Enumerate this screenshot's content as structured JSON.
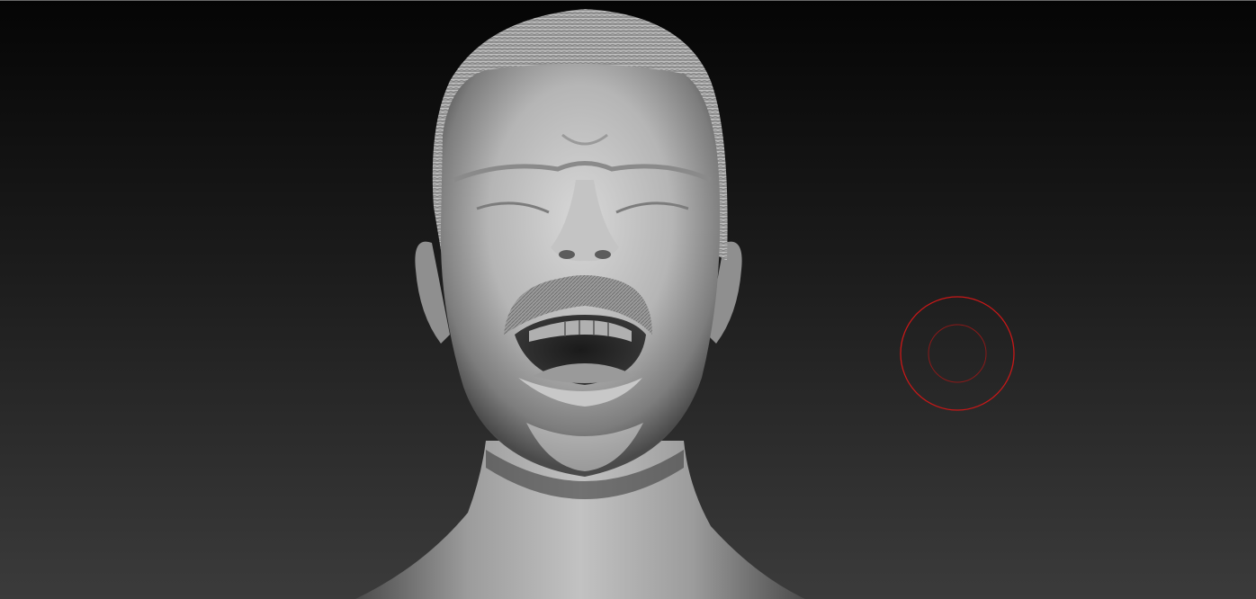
{
  "app": {
    "name": "",
    "mode": "sculpt"
  },
  "viewport": {
    "background_top": "#060606",
    "background_bottom": "#3a3a3a",
    "model": "head-bust",
    "material_color": "#bdbdbd"
  },
  "cursor": {
    "type": "brush",
    "outer_ring_color": "#c81818",
    "inner_ring_color": "#8a1a1a"
  }
}
